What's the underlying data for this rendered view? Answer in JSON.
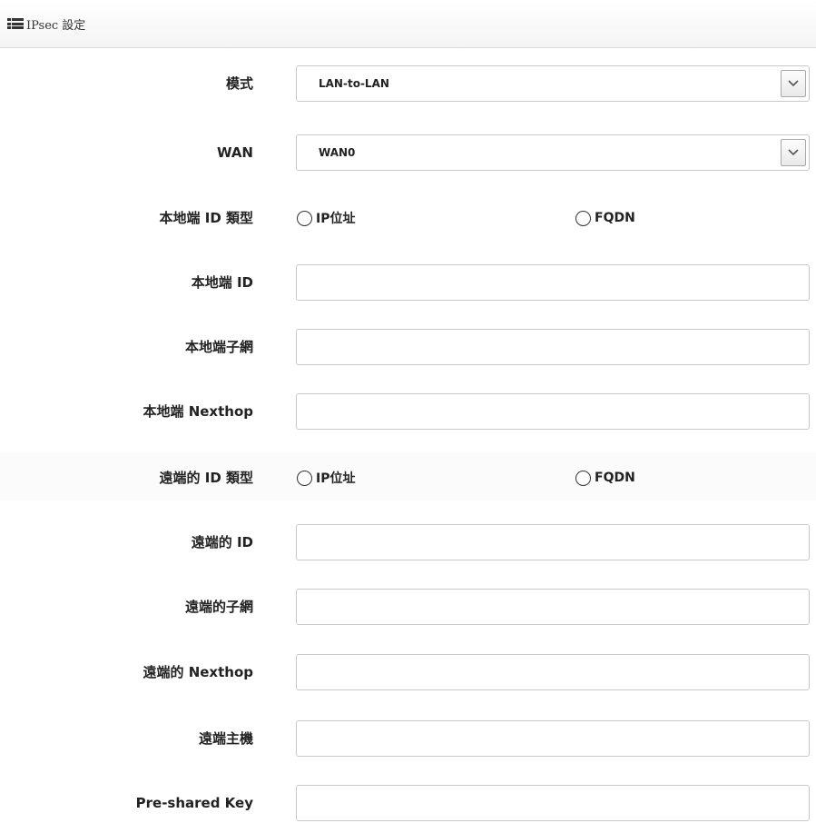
{
  "header": {
    "title": "IPsec 設定",
    "icon": "list-icon"
  },
  "fields": {
    "mode": {
      "label": "模式",
      "selected": "LAN-to-LAN"
    },
    "wan": {
      "label": "WAN",
      "selected": "WAN0"
    },
    "local_id_type": {
      "label": "本地端 ID 類型",
      "options": [
        "IP位址",
        "FQDN"
      ]
    },
    "local_id": {
      "label": "本地端 ID",
      "value": ""
    },
    "local_subnet": {
      "label": "本地端子網",
      "value": ""
    },
    "local_nexthop": {
      "label": "本地端 Nexthop",
      "value": ""
    },
    "remote_id_type": {
      "label": "遠端的 ID 類型",
      "options": [
        "IP位址",
        "FQDN"
      ]
    },
    "remote_id": {
      "label": "遠端的 ID",
      "value": ""
    },
    "remote_subnet": {
      "label": "遠端的子網",
      "value": ""
    },
    "remote_nexthop": {
      "label": "遠端的 Nexthop",
      "value": ""
    },
    "remote_host": {
      "label": "遠端主機",
      "value": ""
    },
    "psk": {
      "label": "Pre-shared Key",
      "value": ""
    }
  }
}
